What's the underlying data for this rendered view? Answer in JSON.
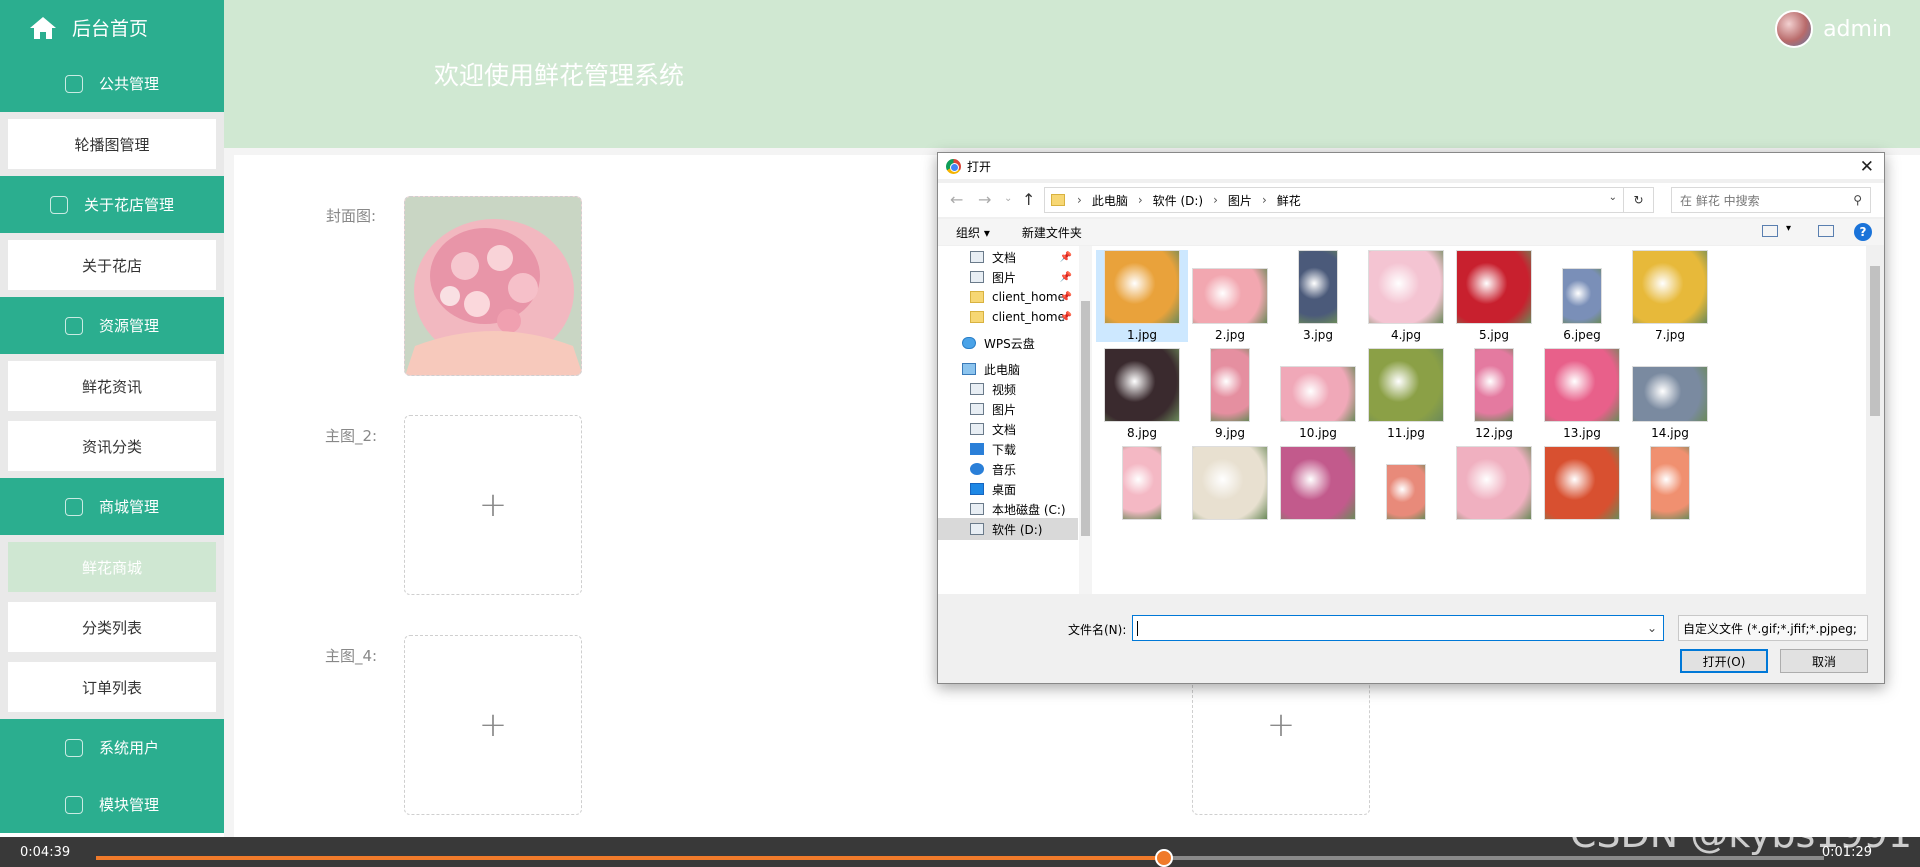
{
  "sidebar": {
    "home_label": "后台首页",
    "groups": [
      {
        "label": "公共管理",
        "items": [
          "轮播图管理"
        ]
      },
      {
        "label": "关于花店管理",
        "items": [
          "关于花店"
        ]
      },
      {
        "label": "资源管理",
        "items": [
          "鲜花资讯",
          "资讯分类"
        ]
      },
      {
        "label": "商城管理",
        "items": [
          "鲜花商城",
          "分类列表",
          "订单列表"
        ]
      },
      {
        "label": "系统用户",
        "items": []
      },
      {
        "label": "模块管理",
        "items": []
      }
    ],
    "active_item": "鲜花商城"
  },
  "header": {
    "title": "欢迎使用鲜花管理系统",
    "username": "admin"
  },
  "form": {
    "cover_label": "封面图:",
    "main2_label": "主图_2:",
    "main4_label": "主图_4:",
    "plus": "+"
  },
  "dialog": {
    "title": "打开",
    "close": "✕",
    "breadcrumb": [
      "此电脑",
      "软件 (D:)",
      "图片",
      "鲜花"
    ],
    "search_placeholder": "在 鲜花 中搜索",
    "toolbar": {
      "organize": "组织 ▾",
      "new_folder": "新建文件夹"
    },
    "nav_items": [
      {
        "label": "文档",
        "pinned": true
      },
      {
        "label": "图片",
        "pinned": true
      },
      {
        "label": "client_home",
        "pinned": true
      },
      {
        "label": "client_home",
        "pinned": true
      },
      {
        "label": "WPS云盘",
        "pinned": false
      },
      {
        "label": "此电脑",
        "pinned": false
      },
      {
        "label": "视频",
        "pinned": false
      },
      {
        "label": "图片",
        "pinned": false
      },
      {
        "label": "文档",
        "pinned": false
      },
      {
        "label": "下载",
        "pinned": false
      },
      {
        "label": "音乐",
        "pinned": false
      },
      {
        "label": "桌面",
        "pinned": false
      },
      {
        "label": "本地磁盘 (C:)",
        "pinned": false
      },
      {
        "label": "软件 (D:)",
        "pinned": false
      }
    ],
    "files": [
      "1.jpg",
      "2.jpg",
      "3.jpg",
      "4.jpg",
      "5.jpg",
      "6.jpeg",
      "7.jpg",
      "8.jpg",
      "9.jpg",
      "10.jpg",
      "11.jpg",
      "12.jpg",
      "13.jpg",
      "14.jpg"
    ],
    "thumb_colors": [
      "#e9a23b",
      "#f2a7b0",
      "#4b5a7a",
      "#f4c4d2",
      "#c8202e",
      "#7a8fb8",
      "#e7b93a",
      "#3a2a2e",
      "#e58fa0",
      "#f0a8b8",
      "#8ba046",
      "#e47aa0",
      "#e8608a",
      "#7a8aa0",
      "#f4b8c4",
      "#e8e0d0",
      "#c25a8c",
      "#e88a7a",
      "#f0b0c0",
      "#d85030",
      "#f09070"
    ],
    "filename_label": "文件名(N):",
    "filename_value": "",
    "filter": "自定义文件 (*.gif;*.jfif;*.pjpeg;",
    "open_button": "打开(O)",
    "cancel_button": "取消"
  },
  "video": {
    "elapsed": "0:04:39",
    "remaining": "0:01:29",
    "progress": 0.618
  },
  "watermark": "CSDN @kybs1991",
  "colors": {
    "brand": "#2bae8f",
    "header": "#d0e8d2",
    "accent": "#f07a2a"
  }
}
